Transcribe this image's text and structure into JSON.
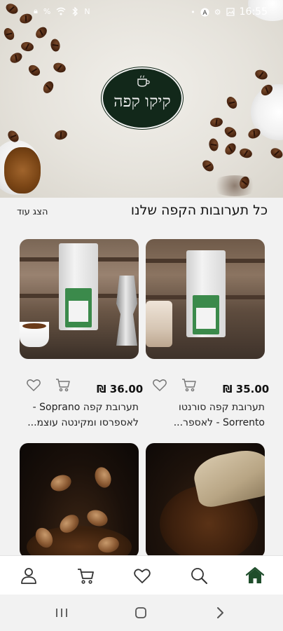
{
  "status_bar": {
    "time": "16:55",
    "left_icons": [
      "lock-icon",
      "percent-icon",
      "wifi-icon",
      "bluetooth-icon",
      "nfc-icon"
    ],
    "right_icons": [
      "dot-icon",
      "a-icon",
      "settings-icon",
      "image-icon"
    ]
  },
  "hero": {
    "logo_text": "קיקו קפה"
  },
  "section": {
    "title": "כל תערובות הקפה שלנו",
    "show_more": "הצג עוד"
  },
  "products": [
    {
      "price": "35.00 ₪",
      "name_line1": "תערובת קפה סורנטו",
      "name_line2": "Sorrento - לאספר..."
    },
    {
      "price": "36.00 ₪",
      "name_line1": "תערובת קפה Soprano -",
      "name_line2": "לאספרסו ומקינטה עוצמ..."
    }
  ],
  "bottom_nav": {
    "items": [
      "home-icon",
      "search-icon",
      "heart-icon",
      "cart-icon",
      "profile-icon"
    ],
    "active": "home"
  },
  "colors": {
    "brand_green": "#1f4d2b",
    "logo_bg": "#12281a",
    "text": "#111111"
  }
}
